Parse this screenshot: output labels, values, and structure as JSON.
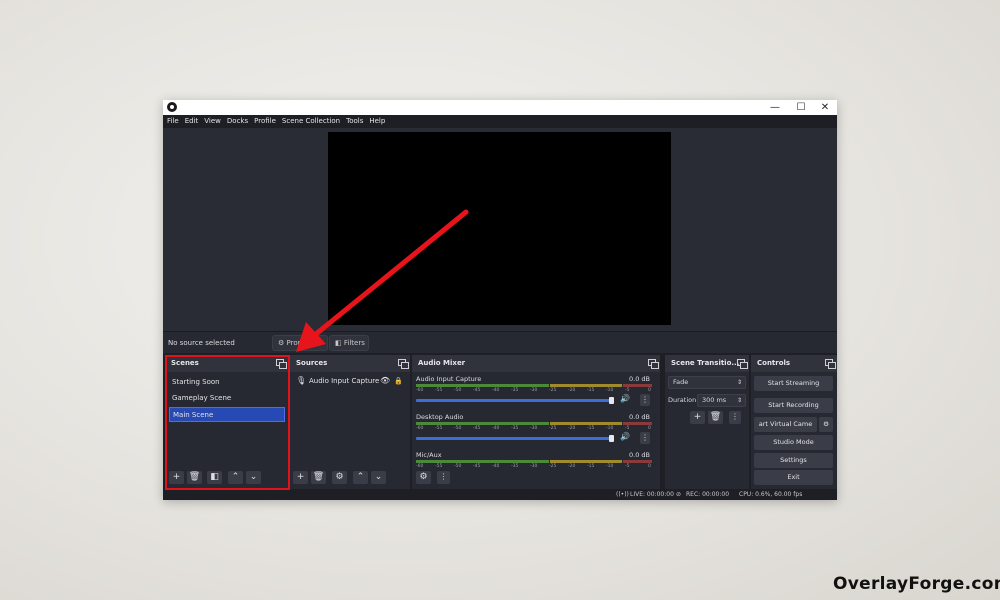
{
  "menu": [
    "File",
    "Edit",
    "View",
    "Docks",
    "Profile",
    "Scene Collection",
    "Tools",
    "Help"
  ],
  "window_controls": {
    "minimize": "—",
    "maximize": "☐",
    "close": "✕"
  },
  "preview_toolbar": {
    "status": "No source selected",
    "properties_label": "Properties",
    "filters_label": "Filters"
  },
  "scenes": {
    "title": "Scenes",
    "items": [
      "Starting Soon",
      "Gameplay Scene",
      "Main Scene"
    ],
    "selected_index": 2
  },
  "sources": {
    "title": "Sources",
    "items": [
      {
        "name": "Audio Input Capture"
      }
    ]
  },
  "audio_mixer": {
    "title": "Audio Mixer",
    "tick_labels": [
      "-60",
      "-55",
      "-50",
      "-45",
      "-40",
      "-35",
      "-30",
      "-25",
      "-20",
      "-15",
      "-10",
      "-5",
      "0"
    ],
    "channels": [
      {
        "name": "Audio Input Capture",
        "db": "0.0 dB"
      },
      {
        "name": "Desktop Audio",
        "db": "0.0 dB"
      },
      {
        "name": "Mic/Aux",
        "db": "0.0 dB"
      }
    ]
  },
  "scene_transitions": {
    "title": "Scene Transitio...",
    "transition": "Fade",
    "duration_label": "Duration",
    "duration_value": "300 ms"
  },
  "controls": {
    "title": "Controls",
    "start_streaming": "Start Streaming",
    "start_recording": "Start Recording",
    "virtual_camera": "art Virtual Came",
    "studio_mode": "Studio Mode",
    "settings": "Settings",
    "exit": "Exit"
  },
  "status_bar": {
    "live": "LIVE: 00:00:00",
    "rec": "REC: 00:00:00",
    "cpu": "CPU: 0.6%, 60.00 fps"
  },
  "watermark": "OverlayForge.com",
  "colors": {
    "highlight": "#e0121b",
    "selected_scene": "#2749b3",
    "volume_slider": "#3b6fd6"
  }
}
